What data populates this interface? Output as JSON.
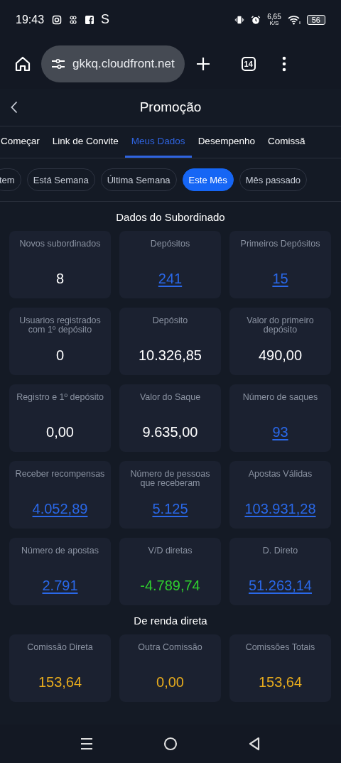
{
  "status_bar": {
    "time": "19:43",
    "app_glyph": "S",
    "net_speed": "6,65",
    "net_unit": "K/S",
    "battery": "56"
  },
  "browser": {
    "url": "gkkq.cloudfront.net",
    "tab_count": "14"
  },
  "header": {
    "title": "Promoção"
  },
  "tabs": [
    {
      "label": "Começar",
      "selected": false
    },
    {
      "label": "Link de Convite",
      "selected": false
    },
    {
      "label": "Meus Dados",
      "selected": true
    },
    {
      "label": "Desempenho",
      "selected": false
    },
    {
      "label": "Comissã",
      "selected": false
    }
  ],
  "periods": [
    {
      "label": "tem",
      "selected": false
    },
    {
      "label": "Está Semana",
      "selected": false
    },
    {
      "label": "Última Semana",
      "selected": false
    },
    {
      "label": "Este Mês",
      "selected": true
    },
    {
      "label": "Mês passado",
      "selected": false
    }
  ],
  "sections": [
    {
      "title": "Dados do Subordinado",
      "cards": [
        {
          "label": "Novos subordinados",
          "value": "8",
          "kind": "plain"
        },
        {
          "label": "Depósitos",
          "value": "241",
          "kind": "link"
        },
        {
          "label": "Primeiros Depósitos",
          "value": "15",
          "kind": "link"
        },
        {
          "label": "Usuarios registrados com 1º depósito",
          "value": "0",
          "kind": "plain"
        },
        {
          "label": "Depósito",
          "value": "10.326,85",
          "kind": "plain"
        },
        {
          "label": "Valor do primeiro depósito",
          "value": "490,00",
          "kind": "plain"
        },
        {
          "label": "Registro e 1º depósito",
          "value": "0,00",
          "kind": "plain"
        },
        {
          "label": "Valor do Saque",
          "value": "9.635,00",
          "kind": "plain"
        },
        {
          "label": "Número de saques",
          "value": "93",
          "kind": "link"
        },
        {
          "label": "Receber recompensas",
          "value": "4.052,89",
          "kind": "link"
        },
        {
          "label": "Número de pessoas que receberam",
          "value": "5.125",
          "kind": "link"
        },
        {
          "label": "Apostas Válidas",
          "value": "103.931,28",
          "kind": "link"
        },
        {
          "label": "Número de apostas",
          "value": "2.791",
          "kind": "link"
        },
        {
          "label": "V/D diretas",
          "value": "-4.789,74",
          "kind": "gain"
        },
        {
          "label": "D. Direto",
          "value": "51.263,14",
          "kind": "link"
        }
      ]
    },
    {
      "title": "De renda direta",
      "cards": [
        {
          "label": "Comissão Direta",
          "value": "153,64",
          "kind": "money"
        },
        {
          "label": "Outra Comissão",
          "value": "0,00",
          "kind": "money"
        },
        {
          "label": "Comissões Totais",
          "value": "153,64",
          "kind": "money"
        }
      ]
    }
  ]
}
